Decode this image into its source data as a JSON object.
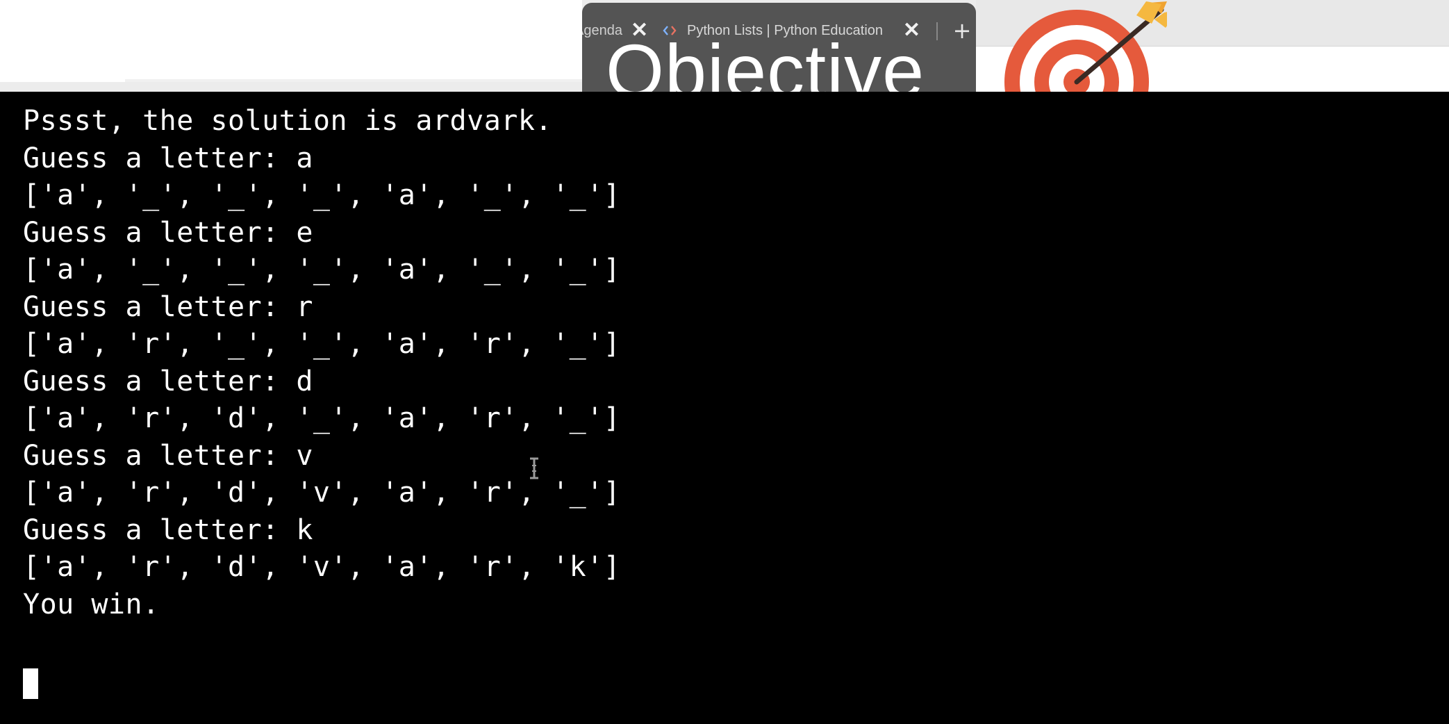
{
  "browser": {
    "tabs": [
      {
        "title": "Agenda",
        "close": "✕"
      },
      {
        "title": "Python Lists | Python Education",
        "close": "✕",
        "favicon": "python-code-icon"
      }
    ],
    "new_tab": "+"
  },
  "overlay": {
    "title": "Objective",
    "icon": "target-arrow-icon",
    "colors": {
      "ring_red": "#e55a3c",
      "ring_white": "#ffffff",
      "arrow_orange": "#f0a330"
    }
  },
  "terminal": {
    "lines": [
      "Pssst, the solution is ardvark.",
      "Guess a letter: a",
      "['a', '_', '_', '_', 'a', '_', '_']",
      "Guess a letter: e",
      "['a', '_', '_', '_', 'a', '_', '_']",
      "Guess a letter: r",
      "['a', 'r', '_', '_', 'a', 'r', '_']",
      "Guess a letter: d",
      "['a', 'r', 'd', '_', 'a', 'r', '_']",
      "Guess a letter: v",
      "['a', 'r', 'd', 'v', 'a', 'r', '_']",
      "Guess a letter: k",
      "['a', 'r', 'd', 'v', 'a', 'r', 'k']",
      "You win."
    ],
    "colors": {
      "background": "#000000",
      "text": "#ffffff"
    }
  }
}
